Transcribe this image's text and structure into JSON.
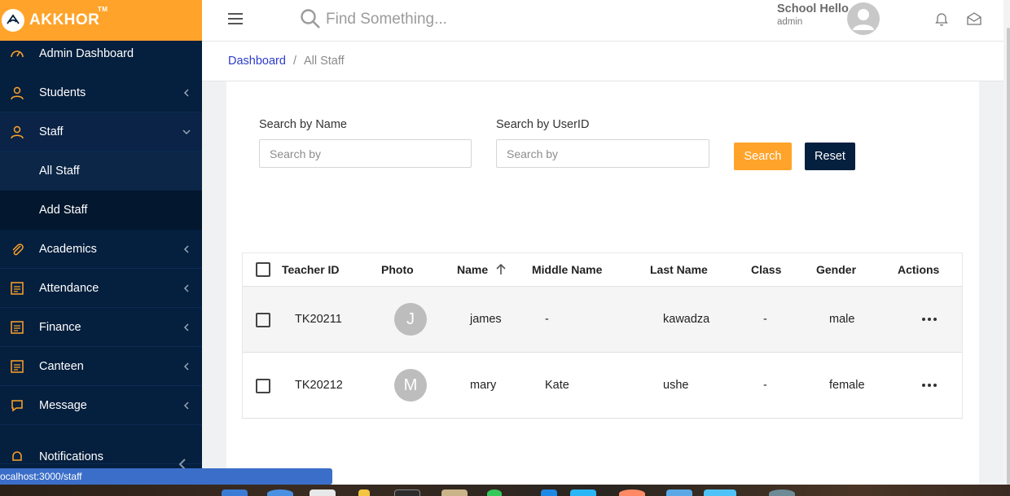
{
  "brand": {
    "name": "AKKHOR",
    "tm": "TM"
  },
  "sidebar": {
    "items": [
      {
        "label": "Admin Dashboard",
        "icon": "dashboard-gauge-icon"
      },
      {
        "label": "Students",
        "icon": "students-icon"
      },
      {
        "label": "Staff",
        "icon": "staff-icon"
      },
      {
        "label": "Academics",
        "icon": "paperclip-icon"
      },
      {
        "label": "Attendance",
        "icon": "list-icon"
      },
      {
        "label": "Finance",
        "icon": "list-icon"
      },
      {
        "label": "Canteen",
        "icon": "list-icon"
      },
      {
        "label": "Message",
        "icon": "chat-icon"
      },
      {
        "label": "Notifications",
        "icon": "bell-icon"
      }
    ],
    "staff_sub": [
      {
        "label": "All Staff"
      },
      {
        "label": "Add Staff"
      }
    ]
  },
  "header": {
    "search_placeholder": "Find Something...",
    "user_name": "School Hello",
    "user_role": "admin"
  },
  "breadcrumb": {
    "home": "Dashboard",
    "separator": "/",
    "current": "All Staff"
  },
  "filters": {
    "name_label": "Search by Name",
    "name_placeholder": "Search by",
    "userid_label": "Search by UserID",
    "userid_placeholder": "Search by",
    "search_button": "Search",
    "reset_button": "Reset"
  },
  "table": {
    "columns": [
      "Teacher ID",
      "Photo",
      "Name",
      "Middle Name",
      "Last Name",
      "Class",
      "Gender",
      "Actions"
    ],
    "sorted_column": "Name",
    "rows": [
      {
        "teacher_id": "TK20211",
        "photo_initial": "J",
        "name": "james",
        "middle_name": "-",
        "last_name": "kawadza",
        "class": "-",
        "gender": "male"
      },
      {
        "teacher_id": "TK20212",
        "photo_initial": "M",
        "name": "mary",
        "middle_name": "Kate",
        "last_name": "ushe",
        "class": "-",
        "gender": "female"
      }
    ]
  },
  "status_bar": {
    "url": "ocalhost:3000/staff"
  },
  "colors": {
    "accent": "#ffa32a",
    "sidebar": "#051f3e",
    "link": "#2d3cc8"
  }
}
